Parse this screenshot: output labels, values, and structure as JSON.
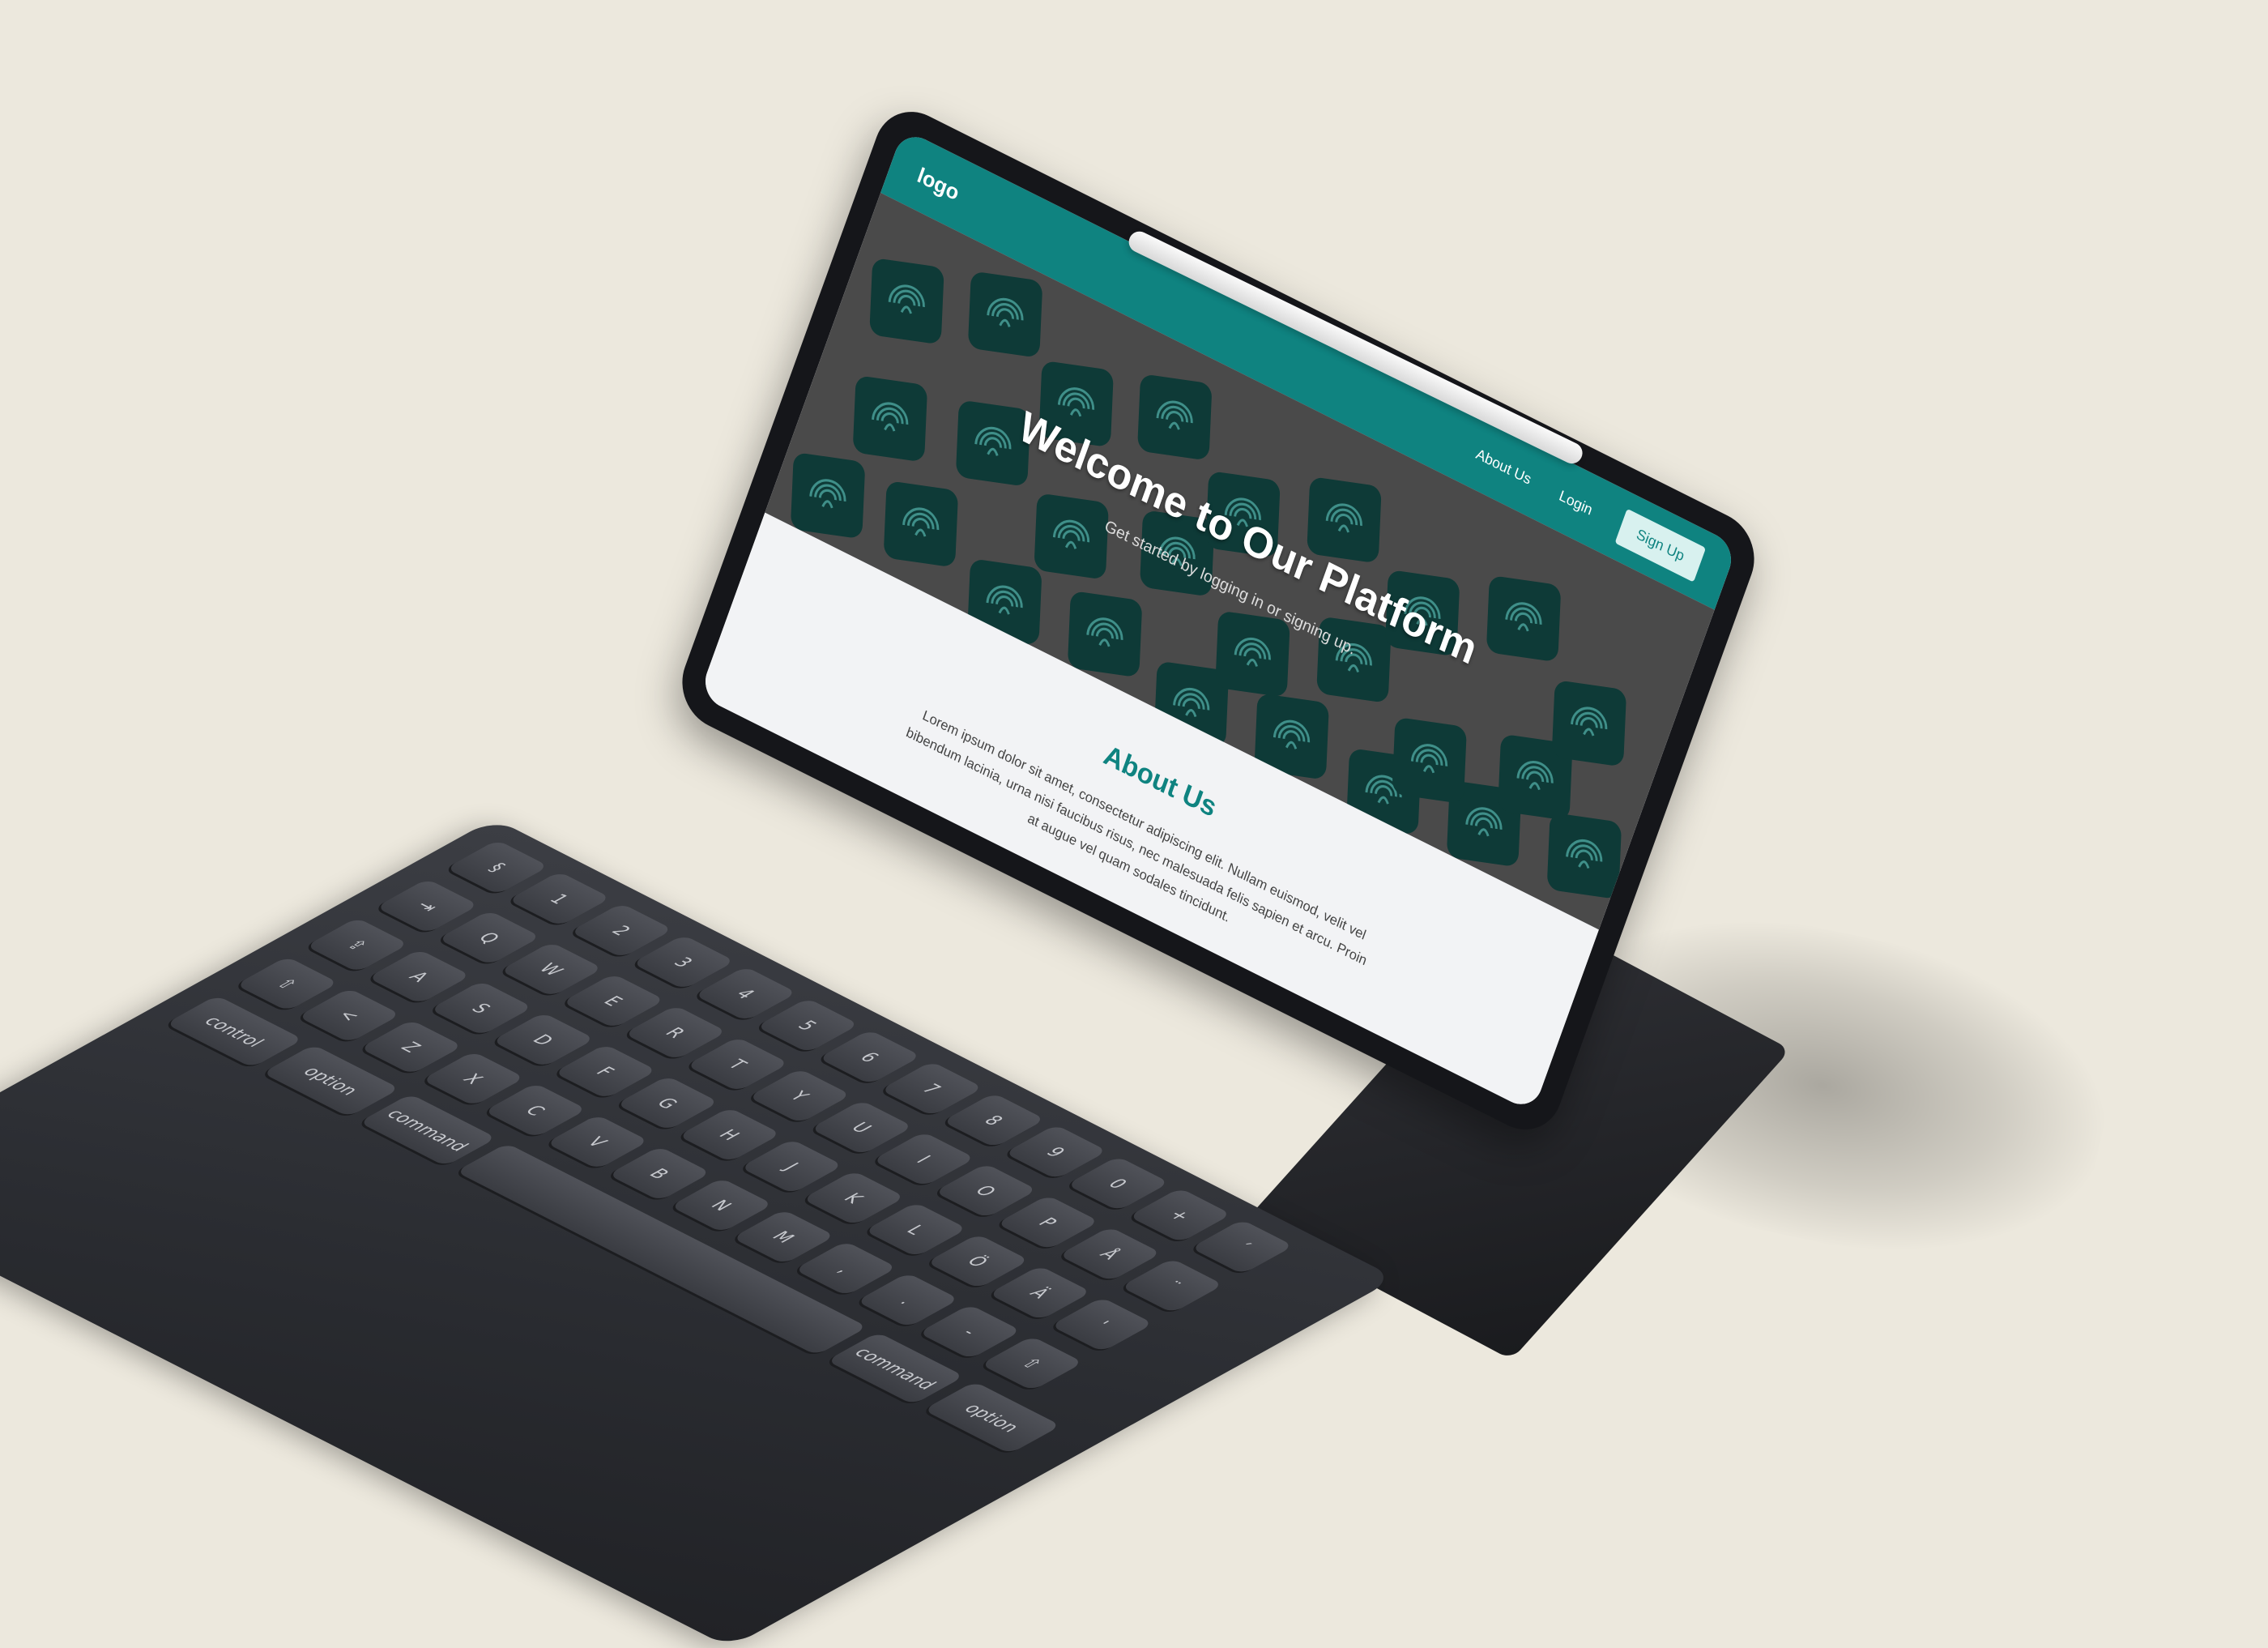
{
  "colors": {
    "background": "#ece8dd",
    "navbar": "#0f8380",
    "hero_bg": "#4a4a4a",
    "tile": "#0e3a37",
    "accent": "#0f8380"
  },
  "navbar": {
    "logo": "logo",
    "links": [
      "About Us",
      "Login"
    ],
    "signup_label": "Sign Up"
  },
  "hero": {
    "title": "Welcome to Our Platform",
    "subtitle": "Get started by logging in or signing up.",
    "tile_icon": "fingerprint-icon"
  },
  "about": {
    "title": "About Us",
    "body": "Lorem ipsum dolor sit amet, consectetur adipiscing elit. Nullam euismod, velit vel bibendum lacinia, urna nisi faucibus risus, nec malesuada felis sapien et arcu. Proin at augue vel quam sodales tincidunt."
  },
  "keyboard": {
    "rows": [
      [
        "§",
        "1",
        "2",
        "3",
        "4",
        "5",
        "6",
        "7",
        "8",
        "9",
        "0",
        "+",
        "´"
      ],
      [
        "⇥",
        "Q",
        "W",
        "E",
        "R",
        "T",
        "Y",
        "U",
        "I",
        "O",
        "P",
        "Å",
        "¨"
      ],
      [
        "⇪",
        "A",
        "S",
        "D",
        "F",
        "G",
        "H",
        "J",
        "K",
        "L",
        "Ö",
        "Ä",
        "'"
      ],
      [
        "⇧",
        "<",
        "Z",
        "X",
        "C",
        "V",
        "B",
        "N",
        "M",
        ",",
        ".",
        "-",
        "⇧"
      ],
      [
        "control",
        "option",
        "command",
        " ",
        "command",
        "option"
      ]
    ]
  }
}
